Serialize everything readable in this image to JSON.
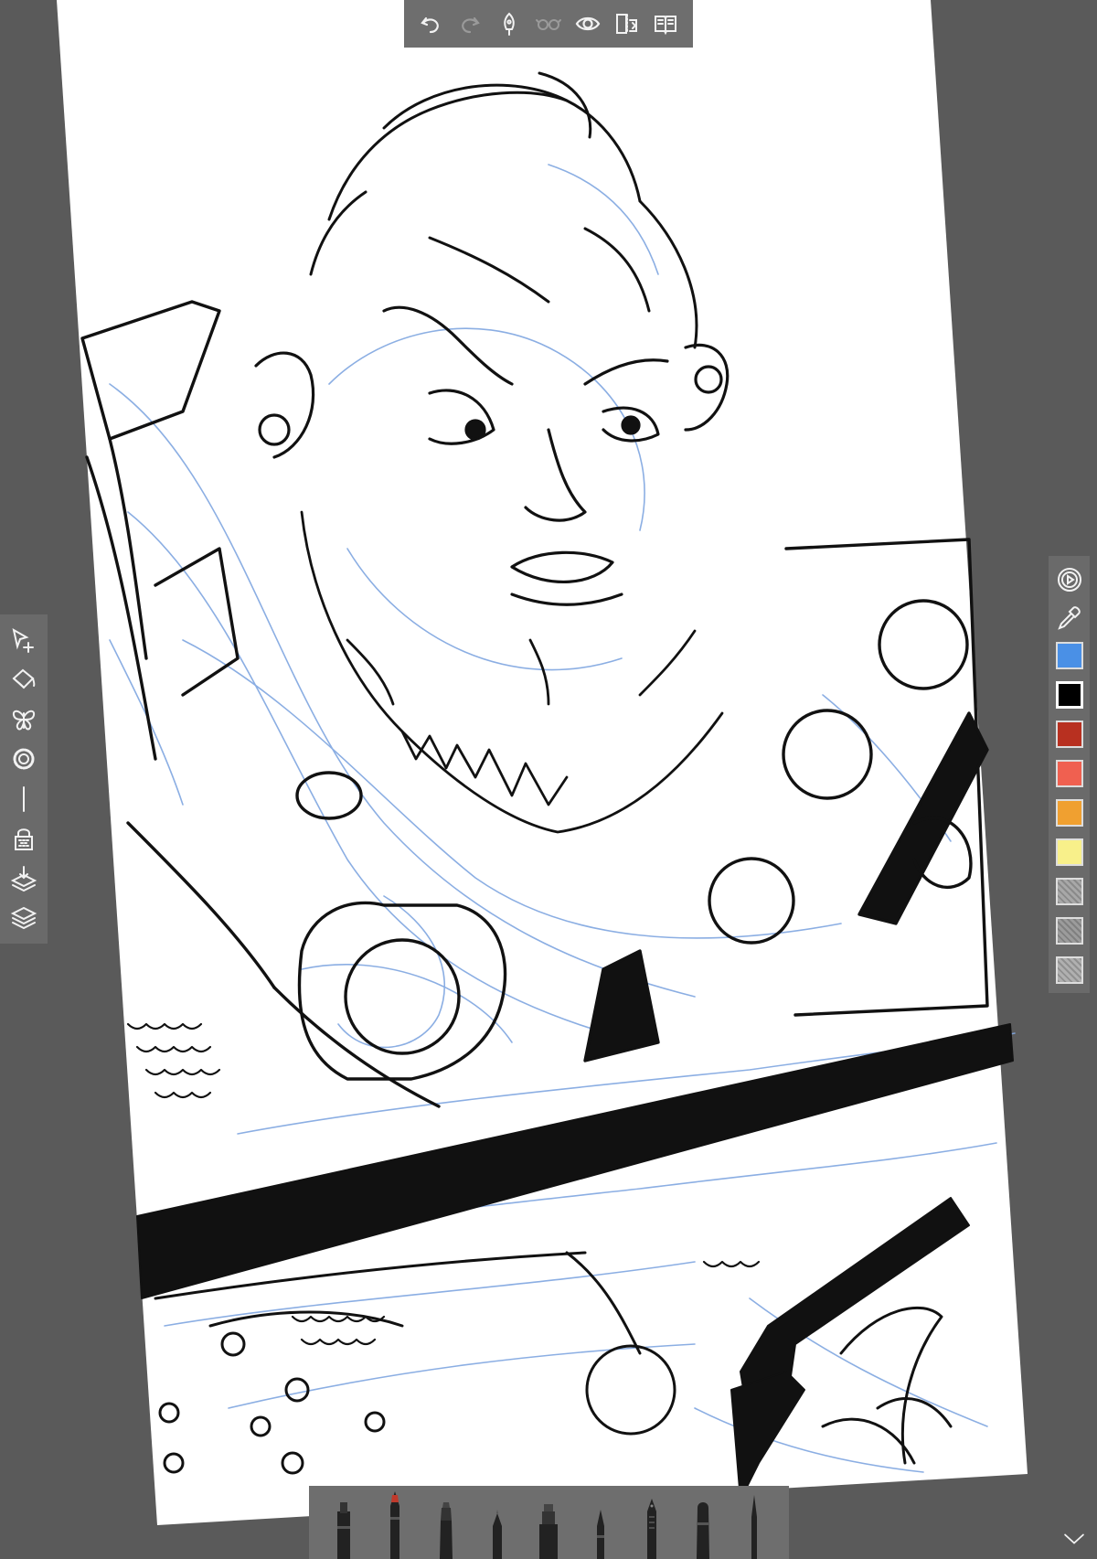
{
  "app": {
    "colors": {
      "workspace": "#5a5a5a",
      "toolbar": "#6e6e6e",
      "icon": "#f2f2f2",
      "icon_disabled": "#9a9a9a"
    }
  },
  "top_toolbar": {
    "items": [
      "undo-icon",
      "redo-icon",
      "pen-nib-icon",
      "glasses-icon",
      "eye-icon",
      "flip-icon",
      "book-icon"
    ]
  },
  "left_toolbar": {
    "items": [
      "transform-select-icon",
      "fill-bucket-icon",
      "symmetry-butterfly-icon",
      "guide-ring-icon",
      "ruler-line-icon",
      "lock-icon",
      "merge-layer-icon",
      "layers-icon"
    ]
  },
  "right_toolbar": {
    "tools": [
      "color-wheel-icon",
      "eyedropper-icon"
    ],
    "swatches": [
      {
        "name": "blue",
        "color": "#4a90e6"
      },
      {
        "name": "black",
        "color": "#000000",
        "selected": true
      },
      {
        "name": "dark-red",
        "color": "#b83020"
      },
      {
        "name": "coral",
        "color": "#f06050"
      },
      {
        "name": "orange",
        "color": "#f0a030"
      },
      {
        "name": "yellow",
        "color": "#f8f08a"
      },
      {
        "name": "grey-texture",
        "color": "#a8a8a8"
      },
      {
        "name": "grey-texture-2",
        "color": "#9c9c9c"
      },
      {
        "name": "scribble-texture",
        "color": "#b0b0b0"
      }
    ]
  },
  "brush_bar": {
    "brushes": [
      "marker-brush",
      "ink-pen-brush",
      "flat-brush",
      "pencil-brush",
      "chisel-marker-brush",
      "fineliner-brush",
      "fountain-pen-brush",
      "round-marker-brush",
      "technical-pen-brush"
    ]
  }
}
